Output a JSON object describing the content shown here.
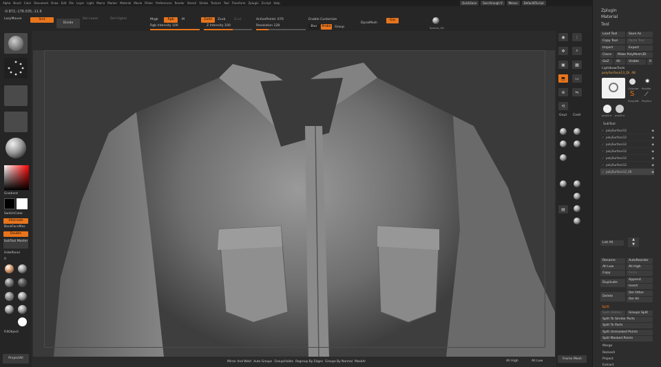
{
  "menu": [
    "Alpha",
    "Brush",
    "Color",
    "Document",
    "Draw",
    "Edit",
    "File",
    "Layer",
    "Light",
    "Macro",
    "Marker",
    "Material",
    "Movie",
    "Picker",
    "Preferences",
    "Render",
    "Stencil",
    "Stroke",
    "Texture",
    "Tool",
    "Transform",
    "Zplugin",
    "Zscript",
    "Help"
  ],
  "topright": [
    "QuickSave",
    "See-through 0",
    "Menus",
    "DefaultZScript"
  ],
  "coords": "-0.872,-176.035,-11.6",
  "top": {
    "lazymouse": "LazyMouse",
    "smt": "Smt",
    "divide": "Divide",
    "del_lower": "Del Lower",
    "del_higher": "Del Higher",
    "mrgb": "Mrgb",
    "rgb": "Rgb",
    "m": "M",
    "zadd": "Zadd",
    "zsub": "Zsub",
    "zcut": "Zcut",
    "rgb_intensity": "Rgb Intensity 100",
    "z_intensity": "Z Intensity 100",
    "active_points": "ActivePoints: 670",
    "enable_customize": "Enable Customize",
    "dynamesh": "DynaMesh",
    "grp": "Grp",
    "resolution": "Resolution 128",
    "blur": "Blur",
    "probe": "Probe",
    "group": "Group",
    "sphere_label": "Sphere_3D"
  },
  "left": {
    "gradient": "Gradient",
    "switchcolor": "SwitchColor",
    "alternate": "Alternate",
    "backfacemask": "BackFaceMas",
    "double": "Double",
    "subtool_master": "SubTool Master",
    "hidepanel": "HidePanel",
    "zero": "0",
    "materials": [
      "MatCap_Gr",
      "Skin",
      "Metal",
      "Basic"
    ],
    "fill_object": "FillObject",
    "project_all": "ProjectAll"
  },
  "right_shelf": [
    "Scroll",
    "Zoom",
    "Actual",
    "AAHalf",
    "Persp",
    "Floor",
    "Local",
    "L.Sym",
    "Move",
    "Scale",
    "Rotate",
    "Xyz",
    "Lsym",
    "Transp",
    "Ghost",
    "Solo",
    "Xpose",
    "Frame",
    "PolyF",
    "Spix"
  ],
  "right_labels": {
    "dynamic": "Dynamic",
    "persp": "Persp",
    "floor": "Floor",
    "move": "Move",
    "scale": "Scale",
    "rotate": "Rotate",
    "frame": "Frame Mesh"
  },
  "palette": {
    "zplugin": "Zplugin",
    "material": "Material",
    "tool": "Tool",
    "load_tool": "Load Tool",
    "save_as": "Save As",
    "copy_tool": "Copy Tool",
    "paste_tool": "Paste Tool",
    "import": "Import",
    "export": "Export",
    "clone": "Clone",
    "make_polymesh": "Make PolyMesh3D",
    "goz": "GoZ",
    "all": "All",
    "visible": "Visible",
    "r": "R",
    "lightbox_tools": "Lightbox▸Tools",
    "current_tool": "polySurface13_Di. 48",
    "tool_thumbs": [
      "Cylinder",
      "PolyMe",
      "SimpleB",
      "PolySur",
      "polySur",
      "polySur"
    ],
    "subtool_header": "SubTool",
    "subtools": [
      "polySurface12",
      "polySurface12",
      "polySurface12",
      "polySurface12",
      "polySurface12",
      "polySurface12",
      "polySurface12_06"
    ],
    "list_all": "List All",
    "rename": "Rename",
    "autoreorder": "AutoReorder",
    "all_low": "All Low",
    "all_high": "All High",
    "copy": "Copy",
    "paste": "Paste",
    "append": "Append",
    "duplicate": "Duplicate",
    "insert": "Insert",
    "delete": "Delete",
    "del_other": "Del Other",
    "del_all": "Del All",
    "split": "Split",
    "split_hidden": "Split Hidden",
    "groups_split": "Groups Split",
    "split_similar": "Split To Similar Parts",
    "split_parts": "Split To Parts",
    "split_unmasked": "Split Unmasked Points",
    "split_masked": "Split Masked Points",
    "merge": "Merge",
    "remesh": "Remesh",
    "project": "Project",
    "extract": "Extract"
  },
  "bottom": [
    "Mirror And Weld",
    "Auto Groups",
    "GroupVisible",
    "Regroup By Edges",
    "Groups By Normal",
    "MaskAr"
  ],
  "bottom_right": [
    "All High",
    "All Low"
  ],
  "colors": {
    "accent": "#e8741c",
    "bg": "#2b2b2b"
  }
}
